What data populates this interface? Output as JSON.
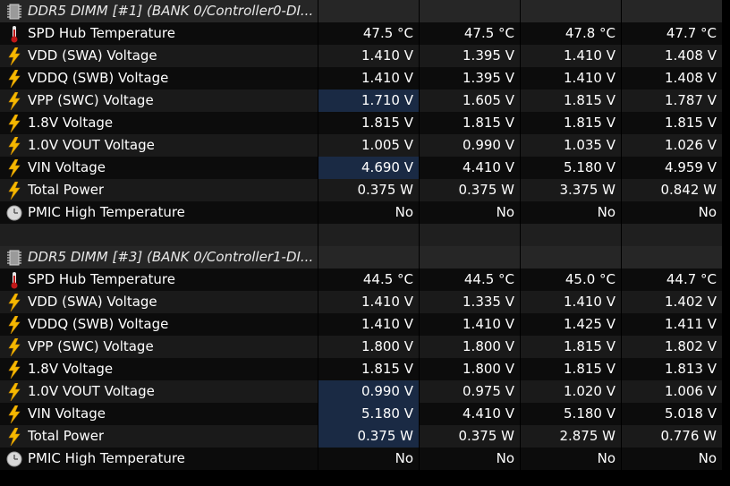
{
  "sections": [
    {
      "title": "DDR5 DIMM [#1] (BANK 0/Controller0-DI...",
      "icon": "memory-chip-icon",
      "rows": [
        {
          "label": "SPD Hub Temperature",
          "icon": "thermometer-icon",
          "values": [
            "47.5 °C",
            "47.5 °C",
            "47.8 °C",
            "47.7 °C"
          ]
        },
        {
          "label": "VDD (SWA) Voltage",
          "icon": "lightning-icon",
          "values": [
            "1.410 V",
            "1.395 V",
            "1.410 V",
            "1.408 V"
          ]
        },
        {
          "label": "VDDQ (SWB) Voltage",
          "icon": "lightning-icon",
          "values": [
            "1.410 V",
            "1.395 V",
            "1.410 V",
            "1.408 V"
          ]
        },
        {
          "label": "VPP (SWC) Voltage",
          "icon": "lightning-icon",
          "values": [
            "1.710 V",
            "1.605 V",
            "1.815 V",
            "1.787 V"
          ]
        },
        {
          "label": "1.8V Voltage",
          "icon": "lightning-icon",
          "values": [
            "1.815 V",
            "1.815 V",
            "1.815 V",
            "1.815 V"
          ]
        },
        {
          "label": "1.0V VOUT Voltage",
          "icon": "lightning-icon",
          "values": [
            "1.005 V",
            "0.990 V",
            "1.035 V",
            "1.026 V"
          ]
        },
        {
          "label": "VIN Voltage",
          "icon": "lightning-icon",
          "values": [
            "4.690 V",
            "4.410 V",
            "5.180 V",
            "4.959 V"
          ]
        },
        {
          "label": "Total Power",
          "icon": "lightning-icon",
          "values": [
            "0.375 W",
            "0.375 W",
            "3.375 W",
            "0.842 W"
          ]
        },
        {
          "label": "PMIC High Temperature",
          "icon": "clock-icon",
          "values": [
            "No",
            "No",
            "No",
            "No"
          ]
        }
      ]
    },
    {
      "title": "DDR5 DIMM [#3] (BANK 0/Controller1-DI...",
      "icon": "memory-chip-icon",
      "rows": [
        {
          "label": "SPD Hub Temperature",
          "icon": "thermometer-icon",
          "values": [
            "44.5 °C",
            "44.5 °C",
            "45.0 °C",
            "44.7 °C"
          ]
        },
        {
          "label": "VDD (SWA) Voltage",
          "icon": "lightning-icon",
          "values": [
            "1.410 V",
            "1.335 V",
            "1.410 V",
            "1.402 V"
          ]
        },
        {
          "label": "VDDQ (SWB) Voltage",
          "icon": "lightning-icon",
          "values": [
            "1.410 V",
            "1.410 V",
            "1.425 V",
            "1.411 V"
          ]
        },
        {
          "label": "VPP (SWC) Voltage",
          "icon": "lightning-icon",
          "values": [
            "1.800 V",
            "1.800 V",
            "1.815 V",
            "1.802 V"
          ]
        },
        {
          "label": "1.8V Voltage",
          "icon": "lightning-icon",
          "values": [
            "1.815 V",
            "1.800 V",
            "1.815 V",
            "1.813 V"
          ]
        },
        {
          "label": "1.0V VOUT Voltage",
          "icon": "lightning-icon",
          "values": [
            "0.990 V",
            "0.975 V",
            "1.020 V",
            "1.006 V"
          ]
        },
        {
          "label": "VIN Voltage",
          "icon": "lightning-icon",
          "values": [
            "5.180 V",
            "4.410 V",
            "5.180 V",
            "5.018 V"
          ]
        },
        {
          "label": "Total Power",
          "icon": "lightning-icon",
          "values": [
            "0.375 W",
            "0.375 W",
            "2.875 W",
            "0.776 W"
          ]
        },
        {
          "label": "PMIC High Temperature",
          "icon": "clock-icon",
          "values": [
            "No",
            "No",
            "No",
            "No"
          ]
        }
      ]
    }
  ],
  "colors": {
    "background": "#000000",
    "row_even": "#1a1a1a",
    "row_odd": "#0c0c0c",
    "header_row": "#262626",
    "highlight": "#1a2a44",
    "text": "#ffffff",
    "lightning": "#f5b800",
    "thermometer": "#c01818"
  }
}
